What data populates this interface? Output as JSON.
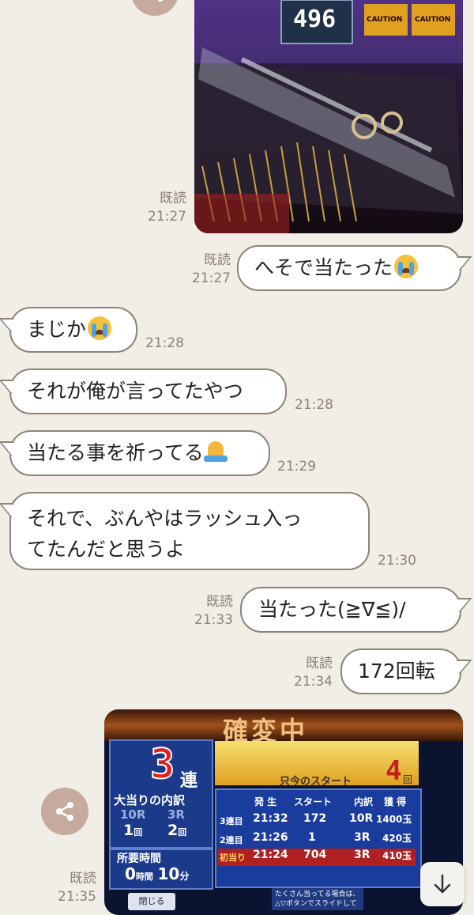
{
  "messages": [
    {
      "id": "m1",
      "meta_read": "既読",
      "meta_time": "21:27"
    },
    {
      "id": "m2",
      "text": "へそで当たった",
      "meta_read": "既読",
      "meta_time": "21:27"
    },
    {
      "id": "m3",
      "text": "まじか",
      "meta_time": "21:28"
    },
    {
      "id": "m4",
      "text": "それが俺が言ってたやつ",
      "meta_time": "21:28"
    },
    {
      "id": "m5",
      "text": "当たる事を祈ってる",
      "meta_time": "21:29"
    },
    {
      "id": "m6",
      "line1": "それで、ぶんやはラッシュ入っ",
      "line2": "てたんだと思うよ",
      "meta_time": "21:30"
    },
    {
      "id": "m7",
      "text": "当たった(≧∇≦)/",
      "meta_read": "既読",
      "meta_time": "21:33"
    },
    {
      "id": "m8",
      "text": "172回転",
      "meta_read": "既読",
      "meta_time": "21:34"
    },
    {
      "id": "m9",
      "meta_read": "既読",
      "meta_time": "21:35"
    }
  ],
  "photo1": {
    "display_number": "496",
    "caution_text": "CAUTION"
  },
  "photo2": {
    "header": "確変中",
    "renchan_count": "3",
    "renchan_label": "連",
    "breakdown_title": "大当りの内訳",
    "col_10r": "10R",
    "col_3r": "3R",
    "count_10r": "1",
    "count_3r": "2",
    "unit_kai": "回",
    "time_label": "所要時間",
    "time_hours": "0",
    "time_hours_unit": "時間",
    "time_minutes": "10",
    "time_minutes_unit": "分",
    "start_label": "只今のスタート",
    "start_value": "4",
    "start_unit": "回",
    "table_headers": [
      "発 生",
      "スタート",
      "内訳",
      "獲 得"
    ],
    "rows": [
      {
        "label": "3連目",
        "time": "21:32",
        "start": "172",
        "type": "10R",
        "gain": "1400玉"
      },
      {
        "label": "2連目",
        "time": "21:26",
        "start": "1",
        "type": "3R",
        "gain": "420玉"
      },
      {
        "label": "初当り",
        "time": "21:24",
        "start": "704",
        "type": "3R",
        "gain": "410玉"
      }
    ],
    "close_button": "閉じる",
    "note_line1": "たくさん当ってる場合は、",
    "note_line2": "△▽ボタンでスライドして"
  },
  "icons": {
    "share": "share-icon",
    "scroll_down": "arrow-down-icon",
    "crying_emoji": "loudly-crying-face-emoji",
    "pray_emoji": "folded-hands-emoji"
  },
  "colors": {
    "background": "#f1ede7",
    "bubble_border": "#8d8378",
    "meta_text": "#8c8276",
    "share_button": "#c6aa9d"
  }
}
